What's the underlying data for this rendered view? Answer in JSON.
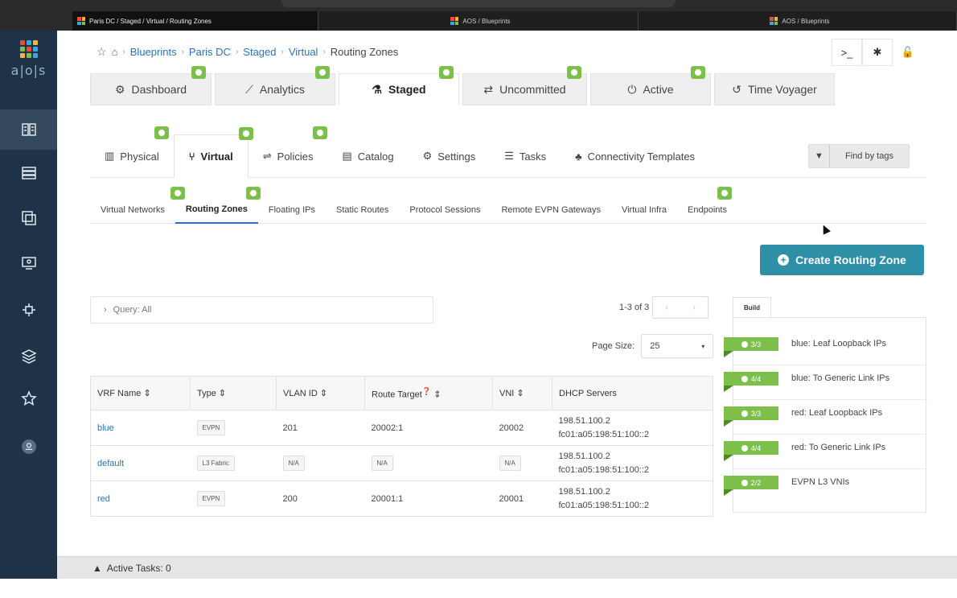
{
  "browser_tabs": [
    {
      "title": "Paris DC / Staged / Virtual / Routing Zones",
      "active": true
    },
    {
      "title": "AOS / Blueprints",
      "active": false
    },
    {
      "title": "AOS / Blueprints",
      "active": false
    }
  ],
  "app": {
    "logo_text": "a|o|s"
  },
  "breadcrumb": {
    "items": [
      "Blueprints",
      "Paris DC",
      "Staged",
      "Virtual"
    ],
    "current": "Routing Zones"
  },
  "main_tabs": [
    "Dashboard",
    "Analytics",
    "Staged",
    "Uncommitted",
    "Active",
    "Time Voyager"
  ],
  "sub_tabs": [
    "Physical",
    "Virtual",
    "Policies",
    "Catalog",
    "Settings",
    "Tasks",
    "Connectivity Templates"
  ],
  "find_by_tags": "Find by tags",
  "virtual_tabs": [
    "Virtual Networks",
    "Routing Zones",
    "Floating IPs",
    "Static Routes",
    "Protocol Sessions",
    "Remote EVPN Gateways",
    "Virtual Infra",
    "Endpoints"
  ],
  "create_button": "Create Routing Zone",
  "query": "Query: All",
  "pager": {
    "range": "1-3 of 3"
  },
  "page_size": {
    "label": "Page Size:",
    "value": "25"
  },
  "table": {
    "headers": [
      "VRF Name",
      "Type",
      "VLAN ID",
      "Route Target",
      "VNI",
      "DHCP Servers"
    ],
    "rows": [
      {
        "name": "blue",
        "type": "EVPN",
        "vlan": "201",
        "rt": "20002:1",
        "vni": "20002",
        "dhcp1": "198.51.100.2",
        "dhcp2": "fc01:a05:198:51:100::2"
      },
      {
        "name": "default",
        "type": "L3 Fabric",
        "vlan": "N/A",
        "rt": "N/A",
        "vni": "N/A",
        "dhcp1": "198.51.100.2",
        "dhcp2": "fc01:a05:198:51:100::2"
      },
      {
        "name": "red",
        "type": "EVPN",
        "vlan": "200",
        "rt": "20001:1",
        "vni": "20001",
        "dhcp1": "198.51.100.2",
        "dhcp2": "fc01:a05:198:51:100::2"
      }
    ]
  },
  "build": {
    "tab_label": "Build",
    "items": [
      {
        "count": "3/3",
        "label": "blue: Leaf Loopback IPs"
      },
      {
        "count": "4/4",
        "label": "blue: To Generic Link IPs"
      },
      {
        "count": "3/3",
        "label": "red: Leaf Loopback IPs"
      },
      {
        "count": "4/4",
        "label": "red: To Generic Link IPs"
      },
      {
        "count": "2/2",
        "label": "EVPN L3 VNIs"
      }
    ]
  },
  "active_tasks": "Active Tasks: 0",
  "colors": {
    "accent": "#2e8fa6",
    "sidebar": "#1e3347",
    "badge": "#7cc04b",
    "link": "#2a72b5"
  }
}
